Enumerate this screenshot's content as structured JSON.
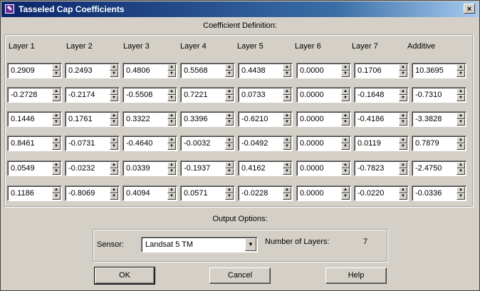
{
  "window": {
    "title": "Tasseled Cap Coefficients",
    "close_label": "×"
  },
  "coefficients": {
    "caption": "Coefficient Definition:",
    "headers": [
      "Layer 1",
      "Layer 2",
      "Layer 3",
      "Layer 4",
      "Layer 5",
      "Layer 6",
      "Layer 7",
      "Additive"
    ],
    "rows": [
      [
        "0.2909",
        "0.2493",
        "0.4806",
        "0.5568",
        "0.4438",
        "0.0000",
        "0.1706",
        "10.3695"
      ],
      [
        "-0.2728",
        "-0.2174",
        "-0.5508",
        "0.7221",
        "0.0733",
        "0.0000",
        "-0.1648",
        "-0.7310"
      ],
      [
        "0.1446",
        "0.1761",
        "0.3322",
        "0.3396",
        "-0.6210",
        "0.0000",
        "-0.4186",
        "-3.3828"
      ],
      [
        "0.8461",
        "-0.0731",
        "-0.4640",
        "-0.0032",
        "-0.0492",
        "0.0000",
        "0.0119",
        "0.7879"
      ],
      [
        "0.0549",
        "-0.0232",
        "0.0339",
        "-0.1937",
        "0.4162",
        "0.0000",
        "-0.7823",
        "-2.4750"
      ],
      [
        "0.1186",
        "-0.8069",
        "0.4094",
        "0.0571",
        "-0.0228",
        "0.0000",
        "-0.0220",
        "-0.0336"
      ]
    ]
  },
  "output": {
    "caption": "Output Options:",
    "sensor_label": "Sensor:",
    "sensor_value": "Landsat 5 TM",
    "layers_label": "Number of Layers:",
    "layers_value": "7"
  },
  "buttons": {
    "ok": "OK",
    "cancel": "Cancel",
    "help": "Help"
  },
  "colors": {
    "title_bar": "#0a246a",
    "dialog_face": "#d4d0c8"
  }
}
